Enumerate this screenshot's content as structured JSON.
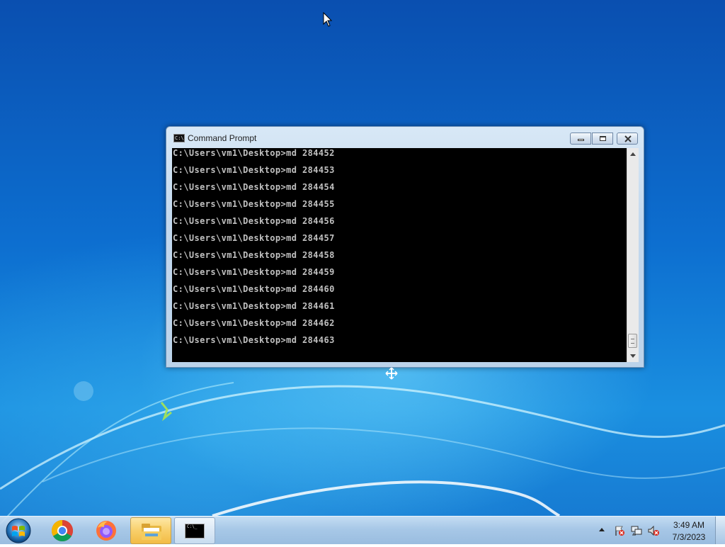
{
  "window": {
    "title": "Command Prompt",
    "console_lines": [
      "C:\\Users\\vm1\\Desktop>md 284452",
      "C:\\Users\\vm1\\Desktop>md 284453",
      "C:\\Users\\vm1\\Desktop>md 284454",
      "C:\\Users\\vm1\\Desktop>md 284455",
      "C:\\Users\\vm1\\Desktop>md 284456",
      "C:\\Users\\vm1\\Desktop>md 284457",
      "C:\\Users\\vm1\\Desktop>md 284458",
      "C:\\Users\\vm1\\Desktop>md 284459",
      "C:\\Users\\vm1\\Desktop>md 284460",
      "C:\\Users\\vm1\\Desktop>md 284461",
      "C:\\Users\\vm1\\Desktop>md 284462",
      "C:\\Users\\vm1\\Desktop>md 284463"
    ],
    "console_colors": {
      "background": "#000000",
      "text": "#c0c0c0"
    },
    "scroll_position": 0.95
  },
  "taskbar": {
    "pinned": [
      {
        "name": "start-button",
        "icon": "windows-logo-icon"
      },
      {
        "name": "chrome",
        "icon": "chrome-icon"
      },
      {
        "name": "firefox",
        "icon": "firefox-icon"
      },
      {
        "name": "file-explorer",
        "icon": "folder-icon",
        "active": true
      },
      {
        "name": "command-prompt",
        "icon": "cmd-icon",
        "open": true
      }
    ],
    "tray_icons": [
      "show-hidden-icons-arrow",
      "action-center-flag-icon",
      "network-icon",
      "volume-muted-icon"
    ],
    "clock": {
      "time": "3:49 AM",
      "date": "7/3/2023"
    }
  }
}
